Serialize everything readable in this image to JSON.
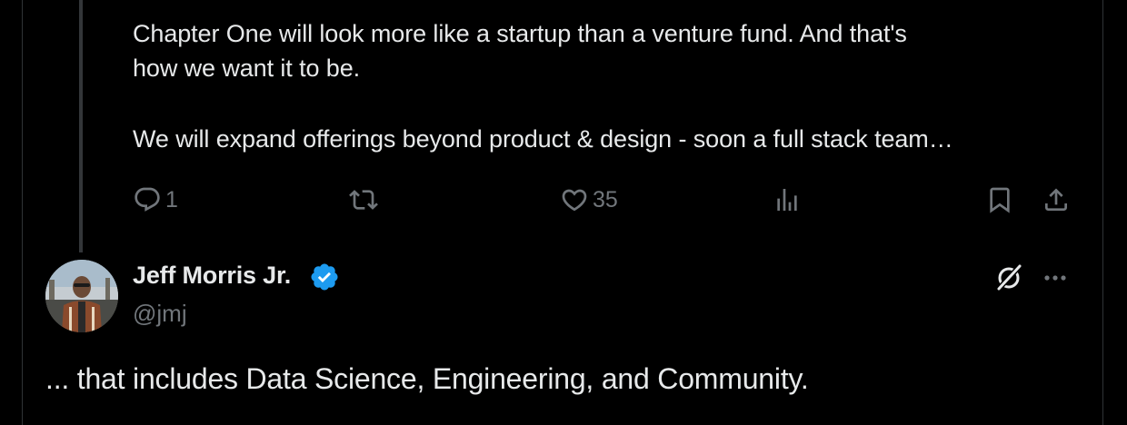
{
  "previous_tweet": {
    "text_lines": [
      "Chapter One will look more like a startup than a venture fund. And that's",
      "how we want it to be.",
      "We will expand offerings beyond product & design - soon a full stack team…"
    ],
    "actions": {
      "reply": {
        "icon": "reply-icon",
        "count": "1"
      },
      "retweet": {
        "icon": "retweet-icon",
        "count": ""
      },
      "like": {
        "icon": "heart-icon",
        "count": "35"
      },
      "views": {
        "icon": "views-icon",
        "count": ""
      },
      "bookmark": {
        "icon": "bookmark-icon"
      },
      "share": {
        "icon": "share-icon"
      }
    }
  },
  "tweet": {
    "author": {
      "name": "Jeff Morris Jr.",
      "handle": "@jmj",
      "verified": true,
      "avatar_icon": "avatar-photo"
    },
    "text": "... that includes Data Science, Engineering, and Community.",
    "menu_icons": [
      "grok-icon",
      "more-icon"
    ]
  },
  "colors": {
    "background": "#000000",
    "text_primary": "#e7e9ea",
    "text_secondary": "#71767b",
    "verified_blue": "#1d9bf0",
    "divider": "#2f3336"
  }
}
